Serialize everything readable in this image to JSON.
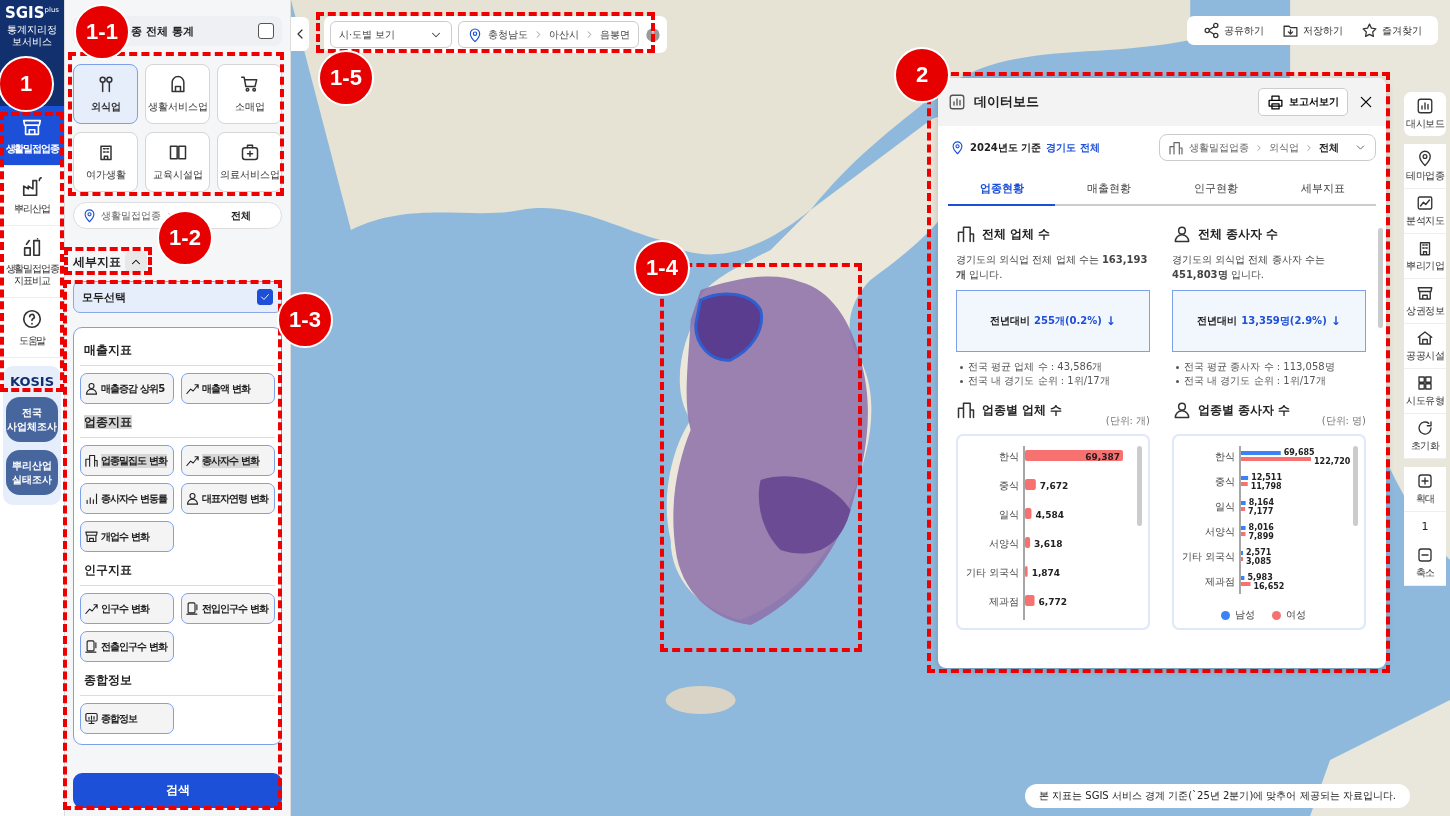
{
  "logo": {
    "name": "SGIS",
    "superscript": "plus",
    "subtitle": "통계지리정보서비스"
  },
  "rail": [
    {
      "label": "생활밀접업종",
      "selected": true
    },
    {
      "label": "뿌리산업",
      "selected": false
    },
    {
      "label": "생활밀접업종 지표비교",
      "selected": false
    },
    {
      "label": "도움말",
      "selected": false
    }
  ],
  "kosis": {
    "title": "KOSIS",
    "buttons": [
      "전국 사업체조사",
      "뿌리산업 실태조사"
    ]
  },
  "all_stats": {
    "label": "종 전체 통계",
    "checked": false
  },
  "categories": [
    {
      "label": "외식업",
      "selected": true
    },
    {
      "label": "생활서비스업",
      "selected": false
    },
    {
      "label": "소매업",
      "selected": false
    },
    {
      "label": "여가생활",
      "selected": false
    },
    {
      "label": "교육시설업",
      "selected": false
    },
    {
      "label": "의료서비스업",
      "selected": false
    }
  ],
  "category_path": [
    "생활밀접업종",
    "전체"
  ],
  "detail": {
    "title": "세부지표",
    "expanded": true,
    "select_all": {
      "label": "모두선택",
      "checked": true
    },
    "groups": [
      {
        "title": "매출지표",
        "highlighted": false,
        "items": [
          {
            "label": "매출증감 상위5",
            "highlighted": false
          },
          {
            "label": "매출액 변화",
            "highlighted": false
          }
        ]
      },
      {
        "title": "업종지표",
        "highlighted": true,
        "items": [
          {
            "label": "업종밀집도 변화",
            "highlighted": true
          },
          {
            "label": "종사자수 변화",
            "highlighted": true
          },
          {
            "label": "종사자수 변동률",
            "highlighted": false
          },
          {
            "label": "대표자연령 변화",
            "highlighted": false
          },
          {
            "label": "개업수 변화",
            "highlighted": false
          }
        ]
      },
      {
        "title": "인구지표",
        "highlighted": false,
        "items": [
          {
            "label": "인구수 변화",
            "highlighted": false
          },
          {
            "label": "전입인구수 변화",
            "highlighted": false
          },
          {
            "label": "전출인구수 변화",
            "highlighted": false
          }
        ]
      },
      {
        "title": "종합정보",
        "highlighted": false,
        "items": [
          {
            "label": "종합정보",
            "highlighted": false
          }
        ]
      }
    ]
  },
  "search_button": "검색",
  "view_select": "시·도별 보기",
  "location_path": [
    "충청남도",
    "아산시",
    "음봉면"
  ],
  "actions": [
    "공유하기",
    "저장하기",
    "즐겨찾기"
  ],
  "dashboard": {
    "title": "데이터보드",
    "report_button": "보고서보기",
    "basis_year": "2024년도 기준",
    "region": "경기도 전체",
    "industry_path": [
      "생활밀접업종",
      "외식업",
      "전체"
    ],
    "tabs": [
      {
        "label": "업종현황",
        "selected": true
      },
      {
        "label": "매출현황",
        "selected": false
      },
      {
        "label": "인구현황",
        "selected": false
      },
      {
        "label": "세부지표",
        "selected": false
      }
    ],
    "cards": [
      {
        "title": "전체 업체 수",
        "text": "경기도의 외식업 전체 업체 수는 **163,193개** 입니다.",
        "compare_label": "전년대비",
        "compare_value": "255개(0.2%)",
        "arrow": "↓",
        "notes": [
          "전국 평균 업체 수 : 43,586개",
          "전국 내 경기도 순위 : 1위/17개"
        ]
      },
      {
        "title": "전체 종사자 수",
        "text": "경기도의 외식업 전체 종사자 수는 **451,803명** 입니다.",
        "compare_label": "전년대비",
        "compare_value": "13,359명(2.9%)",
        "arrow": "↓",
        "notes": [
          "전국 평균 종사자 수 : 113,058명",
          "전국 내 경기도 순위 : 1위/17개"
        ]
      }
    ],
    "charts": [
      {
        "title": "업종별 업체 수",
        "unit": "(단위: 개)",
        "chart_data": {
          "type": "bar",
          "orientation": "horizontal",
          "data_labels": true,
          "categories": [
            "한식",
            "중식",
            "일식",
            "서양식",
            "기타 외국식",
            "제과점"
          ],
          "values": [
            69387,
            7672,
            4584,
            3618,
            1874,
            6772
          ],
          "value_labels": [
            "69,387",
            "7,672",
            "4,584",
            "3,618",
            "1,874",
            "6,772"
          ]
        }
      },
      {
        "title": "업종별 종사자 수",
        "unit": "(단위: 명)",
        "chart_data": {
          "type": "bar",
          "orientation": "horizontal",
          "data_labels": true,
          "legend": "bottom",
          "categories": [
            "한식",
            "중식",
            "일식",
            "서양식",
            "기타 외국식",
            "제과점"
          ],
          "series": [
            {
              "name": "남성",
              "color": "#3b82f6",
              "values": [
                69685,
                12511,
                8164,
                8016,
                2571,
                5983
              ],
              "value_labels": [
                "69,685",
                "12,511",
                "8,164",
                "8,016",
                "2,571",
                "5,983"
              ]
            },
            {
              "name": "여성",
              "color": "#f87171",
              "values": [
                122720,
                11798,
                7177,
                7899,
                3085,
                16652
              ],
              "value_labels": [
                "122,720",
                "11,798",
                "7,177",
                "7,899",
                "3,085",
                "16,652"
              ]
            }
          ]
        }
      }
    ]
  },
  "map_tools": {
    "dashboard": "대시보드",
    "layers": [
      "테마업종",
      "분석지도",
      "뿌리기업",
      "상권정보",
      "공공시설",
      "시도유형",
      "초기화"
    ],
    "zoom_in": "확대",
    "zoom_level": "1",
    "zoom_out": "축소"
  },
  "notice": "본 지표는 SGIS 서비스 경계 기준(`25년 2분기)에 맞추어 제공되는 자료입니다.",
  "annotations": [
    {
      "label": "1"
    },
    {
      "label": "1-1"
    },
    {
      "label": "1-2"
    },
    {
      "label": "1-3"
    },
    {
      "label": "1-4"
    },
    {
      "label": "1-5"
    },
    {
      "label": "2"
    }
  ]
}
